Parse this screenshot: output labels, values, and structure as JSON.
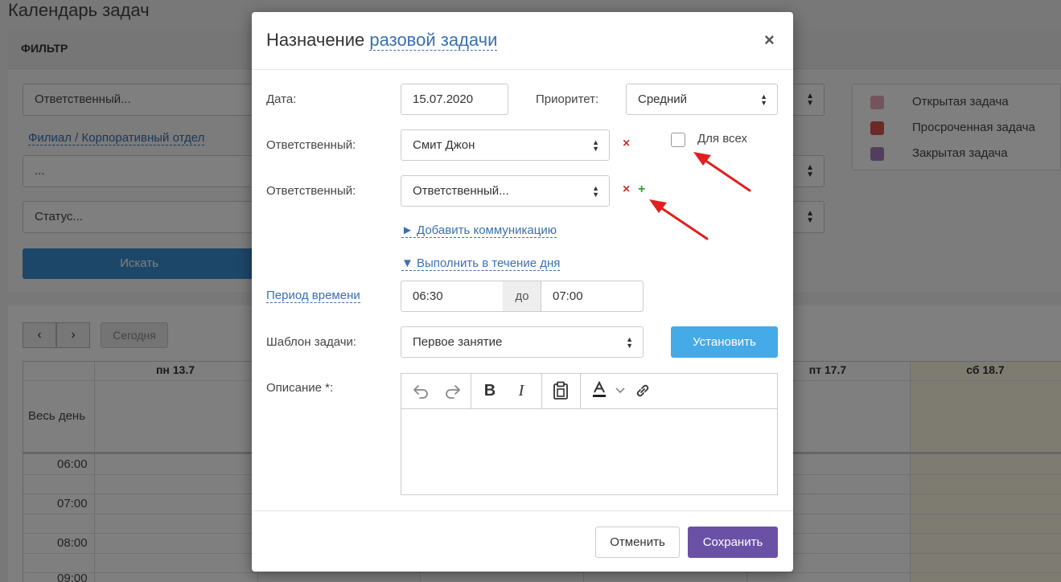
{
  "page": {
    "title": "Календарь задач",
    "filter_title": "ФИЛЬТР",
    "responsible_placeholder": "Ответственный...",
    "branch_link": "Филиал / Корпоративный отдел",
    "branch_value": "...",
    "status_placeholder": "Статус...",
    "search_button": "Искать",
    "legend": [
      {
        "label": "Открытая задача",
        "color": "#e8a8b8"
      },
      {
        "label": "Просроченная задача",
        "color": "#d9534f"
      },
      {
        "label": "Закрытая задача",
        "color": "#a77bbf"
      }
    ],
    "nav": {
      "prev": "‹",
      "next": "›",
      "today": "Сегодня"
    },
    "days": [
      "пн 13.7",
      "пт 17.7",
      "сб 18.7"
    ],
    "all_day": "Весь день",
    "hours": [
      "06:00",
      "07:00",
      "08:00",
      "09:00"
    ]
  },
  "modal": {
    "title_prefix": "Назначение",
    "title_link": "разовой задачи",
    "close": "×",
    "date_label": "Дата:",
    "date_value": "15.07.2020",
    "priority_label": "Приоритет:",
    "priority_value": "Средний",
    "responsible_label": "Ответственный:",
    "responsible_value": "Смит Джон",
    "responsible2_label": "Ответственный:",
    "responsible2_placeholder": "Ответственный...",
    "for_all_label": "Для всех",
    "remove": "×",
    "add": "+",
    "add_communication": "► Добавить коммуникацию",
    "during_day": "▼ Выполнить в течение дня",
    "period_label": "Период времени",
    "time_from": "06:30",
    "time_to_label": "до",
    "time_to": "07:00",
    "template_label": "Шаблон задачи:",
    "template_value": "Первое занятие",
    "set_button": "Установить",
    "description_label": "Описание *:",
    "cancel_button": "Отменить",
    "save_button": "Сохранить"
  },
  "colors": {
    "accent_blue": "#3a70b0",
    "set_button": "#45aae8",
    "save_button": "#6a51a6",
    "annotation_arrow": "#e02020"
  }
}
